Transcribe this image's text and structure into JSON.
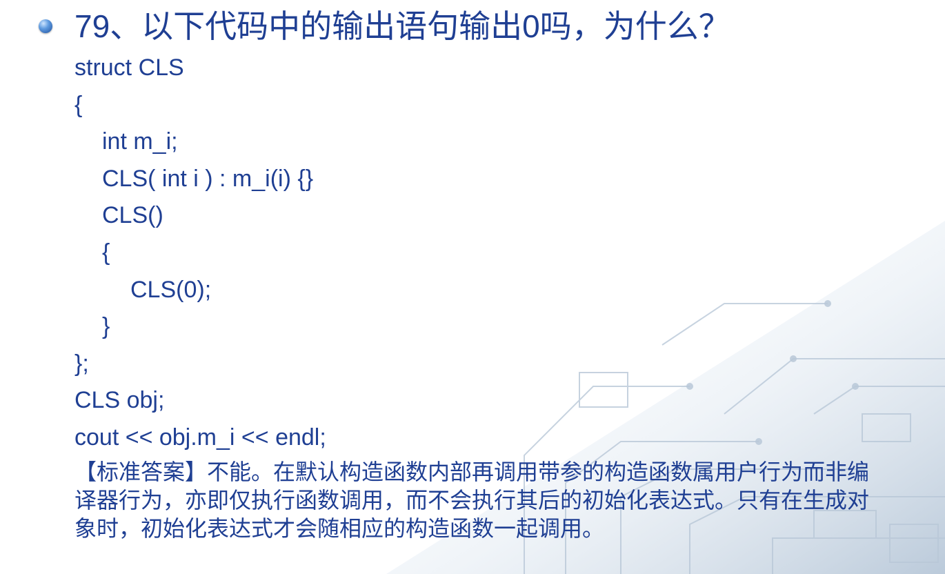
{
  "slide": {
    "title": "79、以下代码中的输出语句输出0吗，为什么？",
    "code_lines": [
      "struct CLS",
      "{",
      "int m_i;",
      "CLS( int i ) : m_i(i) {}",
      "CLS()",
      "{",
      "CLS(0);",
      "}",
      "};",
      "CLS obj;",
      "cout << obj.m_i << endl;"
    ],
    "answer": "【标准答案】不能。在默认构造函数内部再调用带参的构造函数属用户行为而非编译器行为，亦即仅执行函数调用，而不会执行其后的初始化表达式。只有在生成对象时，初始化表达式才会随相应的构造函数一起调用。"
  },
  "colors": {
    "text": "#1f3f93",
    "background_decor": "#c9d6e3"
  },
  "icons": {
    "bullet": "blue-sphere-bullet-icon"
  }
}
